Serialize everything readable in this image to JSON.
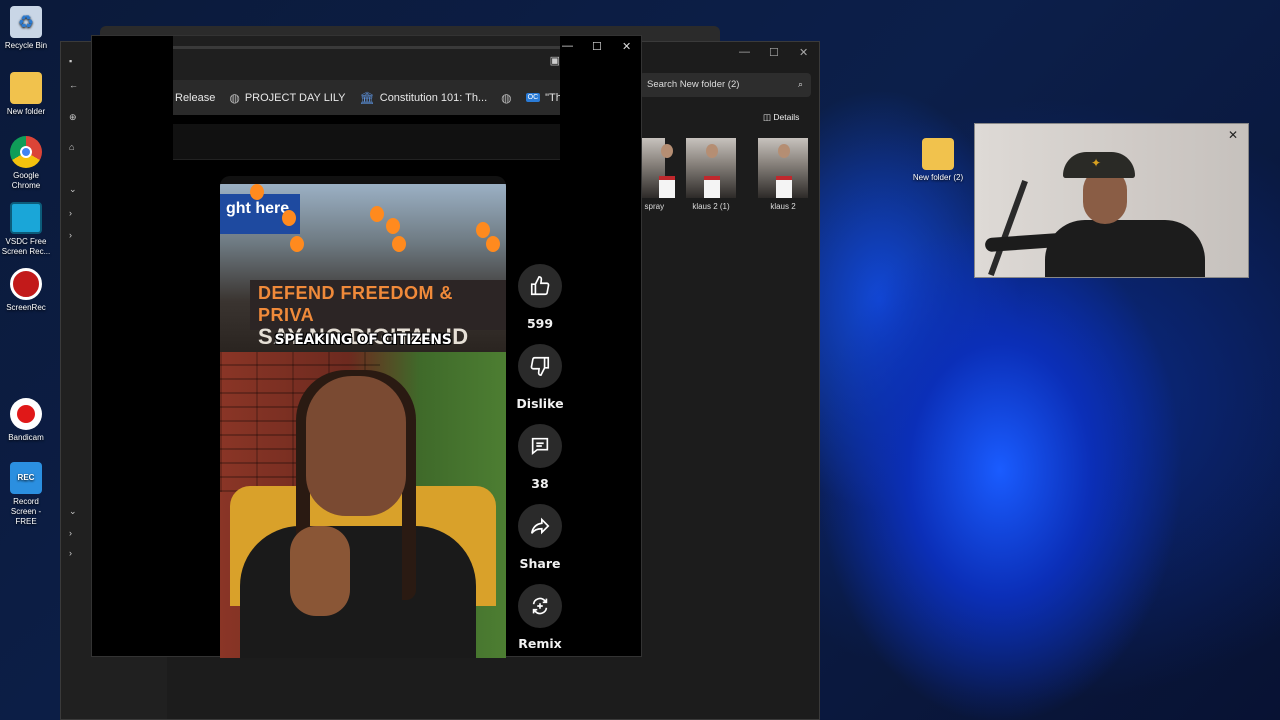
{
  "desktop": {
    "icons": [
      {
        "label": "Recycle Bin",
        "icon": "recycle-bin-icon"
      },
      {
        "label": "New folder",
        "icon": "folder-icon"
      },
      {
        "label": "Google Chrome",
        "icon": "chrome-icon"
      },
      {
        "label": "VSDC Free Screen Rec...",
        "icon": "vsdc-icon"
      },
      {
        "label": "ScreenRec",
        "icon": "screenrec-icon"
      },
      {
        "label": "Bandicam",
        "icon": "bandicam-icon"
      },
      {
        "label": "Record Screen - FREE",
        "icon": "record-screen-icon"
      },
      {
        "label": "New folder (2)",
        "icon": "folder-icon"
      }
    ]
  },
  "explorer": {
    "search_placeholder": "Search New folder (2)",
    "details_label": "Details",
    "files": [
      {
        "name": "h spray"
      },
      {
        "name": "klaus 2 (1)"
      },
      {
        "name": "klaus 2"
      }
    ]
  },
  "browser": {
    "bookmarks": [
      {
        "label": "Release",
        "icon": ""
      },
      {
        "label": "PROJECT DAY LILY",
        "icon": "globe-icon"
      },
      {
        "label": "Constitution 101: Th...",
        "icon": "columns-icon"
      },
      {
        "label": "",
        "icon": "globe-icon"
      },
      {
        "label": "\"The",
        "icon": "oc-icon",
        "badge": "OC"
      }
    ]
  },
  "video": {
    "caption": "SPEAKING OF CITIZENS",
    "banner_line1": "DEFEND FREEDOM & PRIVA",
    "banner_line2": "SAY NO DIGITAL ID",
    "shop_sign": "ght here"
  },
  "actions": {
    "like_count": "599",
    "dislike_label": "Dislike",
    "comment_count": "38",
    "share_label": "Share",
    "remix_label": "Remix"
  },
  "window_controls": {
    "minimize": "—",
    "maximize": "☐",
    "close": "✕"
  }
}
